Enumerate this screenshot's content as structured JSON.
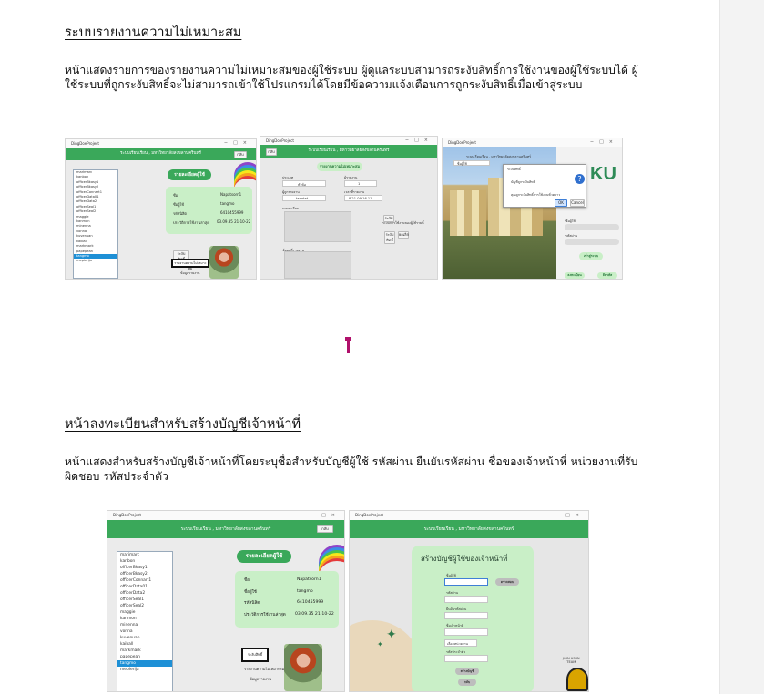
{
  "section1": {
    "heading": "ระบบรายงานความไม่เหมาะสม",
    "paragraph": "หน้าแสดงรายการของรายงานความไม่เหมาะสมของผู้ใช้ระบบ ผู้ดูแลระบบสามารถระงับสิทธิ์การใช้งานของผู้ใช้ระบบได้ ผู้ใช้ระบบที่ถูกระงับสิทธิ์จะไม่สามารถเข้าใช้โปรแกรมได้โดยมีข้อความแจ้งเตือนการถูกระงับสิทธิ์เมื่อเข้าสู่ระบบ"
  },
  "section2": {
    "heading": "หน้าลงทะเบียนสำหรับสร้างบัญชีเจ้าหน้าที่",
    "paragraph": "หน้าแสดงสำหรับสร้างบัญชีเจ้าหน้าที่โดยระบุชื่อสำหรับบัญชีผู้ใช้ รหัสผ่าน ยืนยันรหัสผ่าน ชื่อของเจ้าหน้าที่ หน่วยงานที่รับผิดชอบ รหัสประจำตัว"
  },
  "app": {
    "window_title": "DingDoeProject",
    "header_title": "ระบบเรียนเรียน , มหาวิทยาลัยสงขลานครินทร์",
    "header_button": "กลับ",
    "users_list": [
      "marimarc",
      "kanbon",
      "officerBkasy1",
      "officerBkasy2",
      "officerConnart1",
      "officerData01",
      "officerData2",
      "officerSeal1",
      "officerSeal2",
      "maggie",
      "kanmon",
      "minenna",
      "vonna",
      "kuvenuan",
      "kaiball",
      "markmark",
      "papepean",
      "tangmo",
      "mepierija"
    ],
    "selected_user": "tangmo",
    "profile_title": "รายละเอียดผู้ใช้",
    "profile_fields": [
      {
        "label": "ชื่อ",
        "value": "Napatsorn1"
      },
      {
        "label": "ชื่อผู้ใช้",
        "value": "tangmo"
      },
      {
        "label": "รหัสนิสิต",
        "value": "6410455999"
      },
      {
        "label": "ประวัติการใช้งานล่าสุด",
        "value": "03.09.35 21-10-22"
      }
    ],
    "ban_button": "ระงับสิทธิ์",
    "report_link": "รายงานความไม่เหมาะสม",
    "detail_link": "ข้อมูลรายงาน",
    "report_title": "รายงานความไม่เหมาะสม",
    "report_type_label": "ประเภท",
    "report_type_value": "หัวข้อ",
    "reporter_label": "ผู้รายงาน",
    "reporter_value": "1",
    "reported_label": "ผู้ถูกรายงาน",
    "reported_value": "tanatat",
    "time_label": "เวลาที่รายงาน",
    "time_value": "8  21-09-16 11",
    "detail_label": "รายละเอียด",
    "reason_label": "ข้อมูลที่รายงาน",
    "reason_sub": "รายละเอียด",
    "suspend_note": "ระงับการใช้งานของผู้ใช้รายนี้",
    "ok_button": "ระงับ",
    "cancel_button": "ยกเลิก",
    "login_title": "ระบบเรียนเรียน , มหาวิทยาลัยสงขลานครินทร์",
    "username_field": "ชื่อผู้ใช้",
    "password_field": "รหัสผ่าน",
    "login_button": "เข้าสู่ระบบ",
    "register_button": "ลงทะเบียน",
    "forgot_button": "ลืมรหัส",
    "dialog_title": "ระงับสิทธิ์",
    "dialog_message": "บัญชีถูกระงับสิทธิ์",
    "dialog_detail": "คุณถูกระงับสิทธิ์การใช้งานชั่วคราว",
    "dialog_ok": "OK",
    "dialog_cancel": "Cancel",
    "logo_text": "KU",
    "register_title": "สร้างบัญชีผู้ใช้ของเจ้าหน้าที่",
    "reg_fields": [
      "ชื่อผู้ใช้",
      "รหัสผ่าน",
      "ยืนยันรหัสผ่าน",
      "ชื่อเจ้าหน้าที่",
      "หน่วยงาน",
      "รหัสประจำตัว"
    ],
    "reg_check_button": "ตรวจสอบ",
    "reg_dropdown": "เลือกหน่วยงาน",
    "reg_submit": "สร้างบัญชี",
    "reg_back": "กลับ",
    "reg_side_text": "JOIN US IN\nTEAM"
  },
  "colors": {
    "accent_green": "#3aa85a",
    "panel_green": "#c9efc7",
    "selection_blue": "#1e90d6",
    "caret": "#b0106b"
  }
}
